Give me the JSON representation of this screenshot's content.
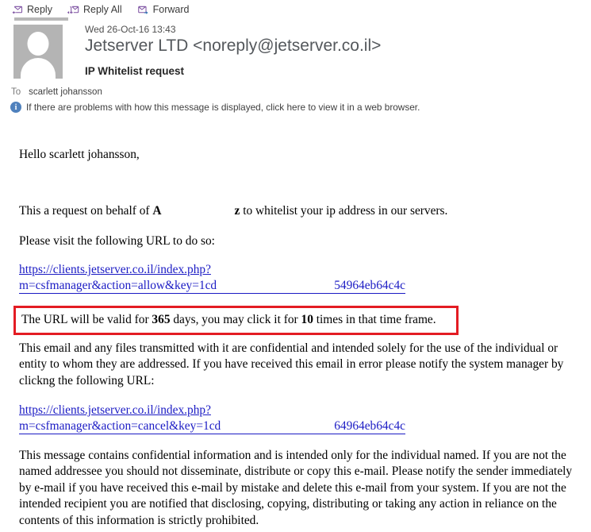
{
  "toolbar": {
    "buttons": [
      {
        "label": "Reply",
        "icon": "reply-icon"
      },
      {
        "label": "Reply All",
        "icon": "reply-all-icon"
      },
      {
        "label": "Forward",
        "icon": "forward-icon"
      }
    ]
  },
  "header": {
    "date": "Wed 26-Oct-16 13:43",
    "from": "Jetserver LTD <noreply@jetserver.co.il>",
    "subject": "IP Whitelist request",
    "to_label": "To",
    "to_value": "scarlett johansson",
    "avatar_icon": "person-placeholder-icon"
  },
  "infobar": {
    "icon": "info-icon",
    "icon_glyph": "i",
    "text": "If there are problems with how this message is displayed, click here to view it in a web browser."
  },
  "message": {
    "greeting": "Hello scarlett johansson,",
    "request_prefix": "This a request on behalf of ",
    "request_name_start": "A",
    "request_name_end": "z",
    "request_suffix": " to whitelist your ip address in our servers.",
    "visit_instruction": "Please visit the following URL to do so:",
    "url_allow": {
      "line1": "https://clients.jetserver.co.il/index.php?",
      "line2": "m=csfmanager&action=allow&key=1cd",
      "line2_tail": "54964eb64c4c"
    },
    "validity": {
      "prefix": "The URL will be valid for ",
      "days": "365",
      "middle": " days, you may click it for ",
      "clicks": "10",
      "suffix": " times in that time frame."
    },
    "confidential_notice": "This email and any files transmitted with it are confidential and intended solely for the use of the individual or entity to whom they are addressed. If you have received this email in error please notify the system manager by clickng the following URL:",
    "url_cancel": {
      "line1": "https://clients.jetserver.co.il/index.php?",
      "line2": "m=csfmanager&action=cancel&key=1cd",
      "line2_tail": "64964eb64c4c"
    },
    "final_notice": "This message contains confidential information and is intended only for the individual named. If you are not the named addressee you should not disseminate, distribute or copy this e-mail. Please notify the sender immediately by e-mail if you have received this e-mail by mistake and delete this e-mail from your system. If you are not the intended recipient you are notified that disclosing, copying, distributing or taking any action in reliance on the contents of this information is strictly prohibited."
  },
  "colors": {
    "link": "#1b1bc4",
    "highlight_border": "#e31c23",
    "info_blue": "#4f81bd",
    "reply_arrow": "#7b4fa0",
    "forward_arrow": "#2e74b5"
  }
}
